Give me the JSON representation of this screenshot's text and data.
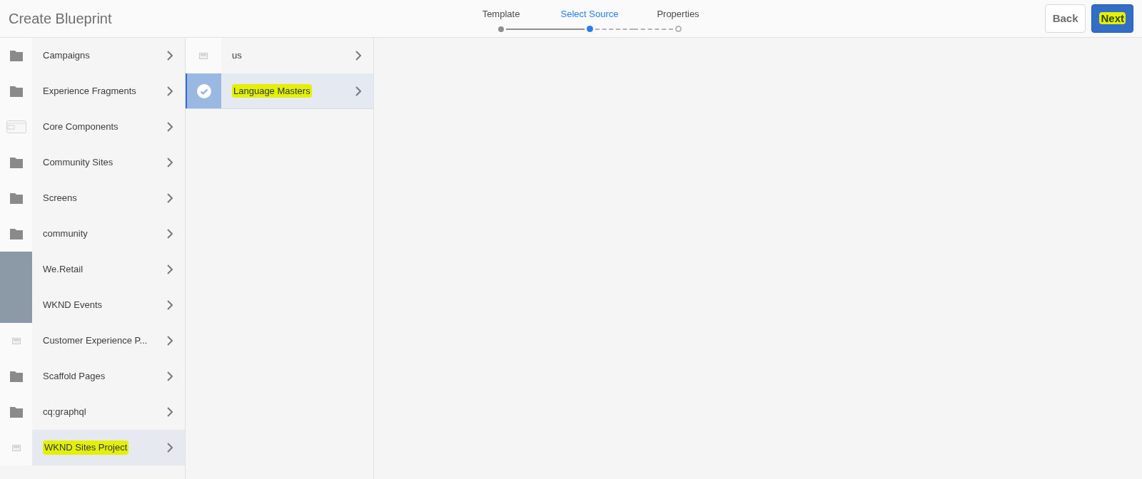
{
  "header": {
    "title": "Create Blueprint",
    "steps": [
      {
        "label": "Template",
        "kind": "done"
      },
      {
        "label": "Select Source",
        "kind": "current"
      },
      {
        "label": "Properties",
        "kind": "pending"
      }
    ],
    "buttons": [
      {
        "label": "Back",
        "kind": "secondary",
        "highlighted": false
      },
      {
        "label": "Next",
        "kind": "primary",
        "highlighted": true
      }
    ]
  },
  "columns": [
    {
      "items": [
        {
          "label": "Campaigns",
          "kind": "folder",
          "selected": false,
          "highlighted": false
        },
        {
          "label": "Experience Fragments",
          "kind": "folder",
          "selected": false,
          "highlighted": false
        },
        {
          "label": "Core Components",
          "kind": "component",
          "selected": false,
          "highlighted": false
        },
        {
          "label": "Community Sites",
          "kind": "folder",
          "selected": false,
          "highlighted": false
        },
        {
          "label": "Screens",
          "kind": "folder",
          "selected": false,
          "highlighted": false
        },
        {
          "label": "community",
          "kind": "folder",
          "selected": false,
          "highlighted": false
        },
        {
          "label": "We.Retail",
          "kind": "photo",
          "selected": false,
          "highlighted": false
        },
        {
          "label": "WKND Events",
          "kind": "photo",
          "selected": false,
          "highlighted": false
        },
        {
          "label": "Customer Experience P...",
          "kind": "page",
          "selected": false,
          "highlighted": false
        },
        {
          "label": "Scaffold Pages",
          "kind": "folder",
          "selected": false,
          "highlighted": false
        },
        {
          "label": "cq:graphql",
          "kind": "folder",
          "selected": false,
          "highlighted": false
        },
        {
          "label": "WKND Sites Project",
          "kind": "page",
          "selected": true,
          "highlighted": true
        }
      ]
    },
    {
      "items": [
        {
          "label": "us",
          "kind": "page",
          "selected": false,
          "checked": false,
          "highlighted": false
        },
        {
          "label": "Language Masters",
          "selected": true,
          "checked": true,
          "highlighted": true
        }
      ]
    }
  ]
}
